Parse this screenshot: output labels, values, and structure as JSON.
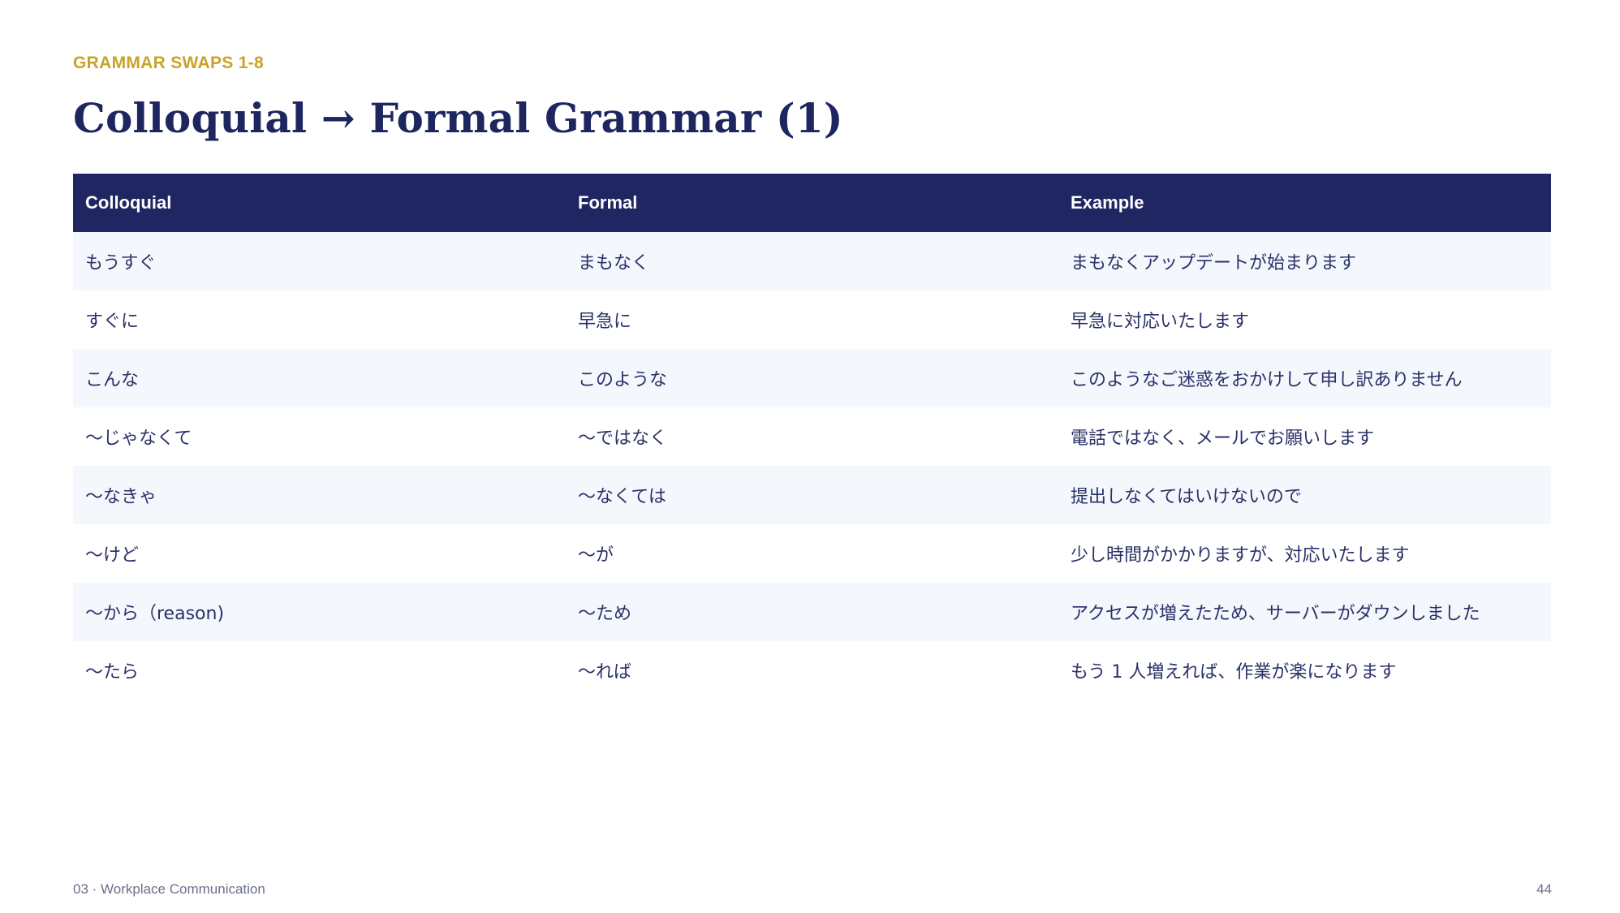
{
  "header": {
    "eyebrow": "GRAMMAR SWAPS 1-8",
    "title": "Colloquial → Formal Grammar (1)"
  },
  "table": {
    "columns": [
      "Colloquial",
      "Formal",
      "Example"
    ],
    "rows": [
      [
        "もうすぐ",
        "まもなく",
        "まもなくアップデートが始まります"
      ],
      [
        "すぐに",
        "早急に",
        "早急に対応いたします"
      ],
      [
        "こんな",
        "このような",
        "このようなご迷惑をおかけして申し訳ありません"
      ],
      [
        "〜じゃなくて",
        "〜ではなく",
        "電話ではなく、メールでお願いします"
      ],
      [
        "〜なきゃ",
        "〜なくては",
        "提出しなくてはいけないので"
      ],
      [
        "〜けど",
        "〜が",
        "少し時間がかかりますが、対応いたします"
      ],
      [
        "〜から（reason)",
        "〜ため",
        "アクセスが増えたため、サーバーがダウンしました"
      ],
      [
        "〜たら",
        "〜れば",
        "もう 1 人増えれば、作業が楽になります"
      ]
    ]
  },
  "footer": {
    "section": "03 · Workplace Communication",
    "page_number": "44"
  },
  "colors": {
    "accent_gold": "#c9a227",
    "navy": "#1f2662",
    "stripe": "#f4f7fc"
  }
}
